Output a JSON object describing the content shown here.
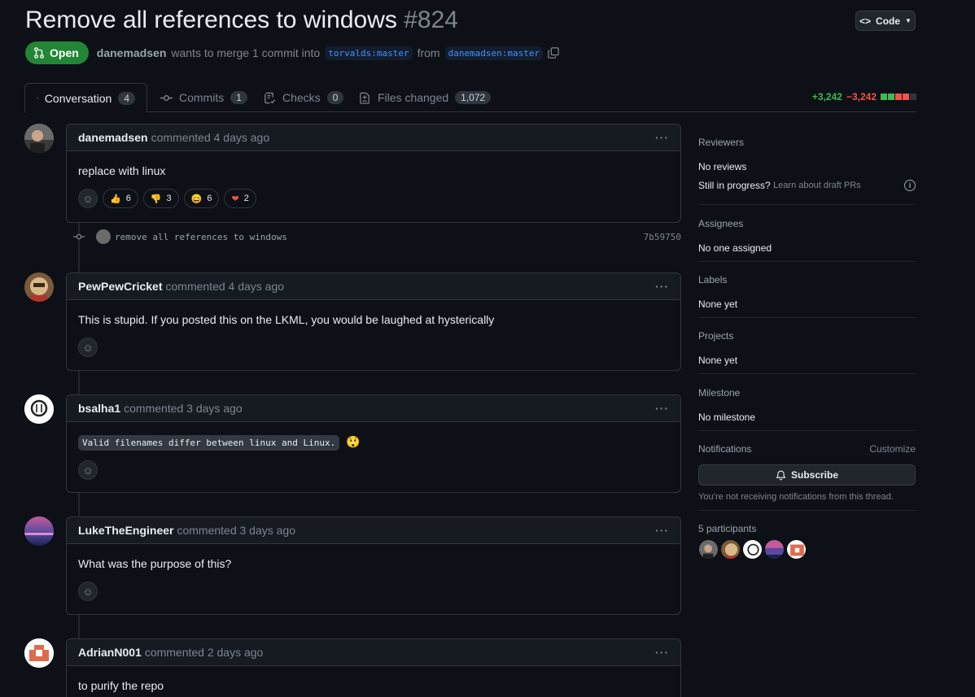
{
  "pr": {
    "title": "Remove all references to windows",
    "number": "#824",
    "state": "Open",
    "author": "danemadsen",
    "merge_text": "wants to merge 1 commit into",
    "base_branch": "torvalds:master",
    "from_text": "from",
    "head_branch": "danemadsen:master"
  },
  "code_button": "Code",
  "tabs": [
    {
      "label": "Conversation",
      "count": "4"
    },
    {
      "label": "Commits",
      "count": "1"
    },
    {
      "label": "Checks",
      "count": "0"
    },
    {
      "label": "Files changed",
      "count": "1,072"
    }
  ],
  "diffstat": {
    "additions": "+3,242",
    "deletions": "−3,242"
  },
  "comments": [
    {
      "author": "danemadsen",
      "time": "commented 4 days ago",
      "body": "replace with linux",
      "reactions": [
        {
          "emoji": "👍",
          "count": "6"
        },
        {
          "emoji": "👎",
          "count": "3"
        },
        {
          "emoji": "😄",
          "count": "6"
        },
        {
          "emoji": "❤",
          "count": "2"
        }
      ]
    },
    {
      "author": "PewPewCricket",
      "time": "commented 4 days ago",
      "body": "This is stupid. If you posted this on the LKML, you would be laughed at hysterically"
    },
    {
      "author": "bsalha1",
      "time": "commented 3 days ago",
      "code": "Valid filenames differ between linux and Linux.",
      "emoji": "😲"
    },
    {
      "author": "LukeTheEngineer",
      "time": "commented 3 days ago",
      "body": "What was the purpose of this?"
    },
    {
      "author": "AdrianN001",
      "time": "commented 2 days ago",
      "body": "to purify the repo"
    }
  ],
  "commit": {
    "message": "remove all references to windows",
    "sha": "7b59750"
  },
  "sidebar": {
    "reviewers": {
      "heading": "Reviewers",
      "value": "No reviews",
      "draft": "Still in progress?",
      "draft_link": "Learn about draft PRs"
    },
    "assignees": {
      "heading": "Assignees",
      "value": "No one assigned"
    },
    "labels": {
      "heading": "Labels",
      "value": "None yet"
    },
    "projects": {
      "heading": "Projects",
      "value": "None yet"
    },
    "milestone": {
      "heading": "Milestone",
      "value": "No milestone"
    },
    "notifications": {
      "heading": "Notifications",
      "customize": "Customize",
      "button": "Subscribe",
      "note": "You’re not receiving notifications from this thread."
    },
    "participants": {
      "heading": "5 participants"
    }
  },
  "colors": {
    "open": "#238636",
    "additions": "#3fb950",
    "deletions": "#f85149",
    "link": "#4493f8"
  }
}
